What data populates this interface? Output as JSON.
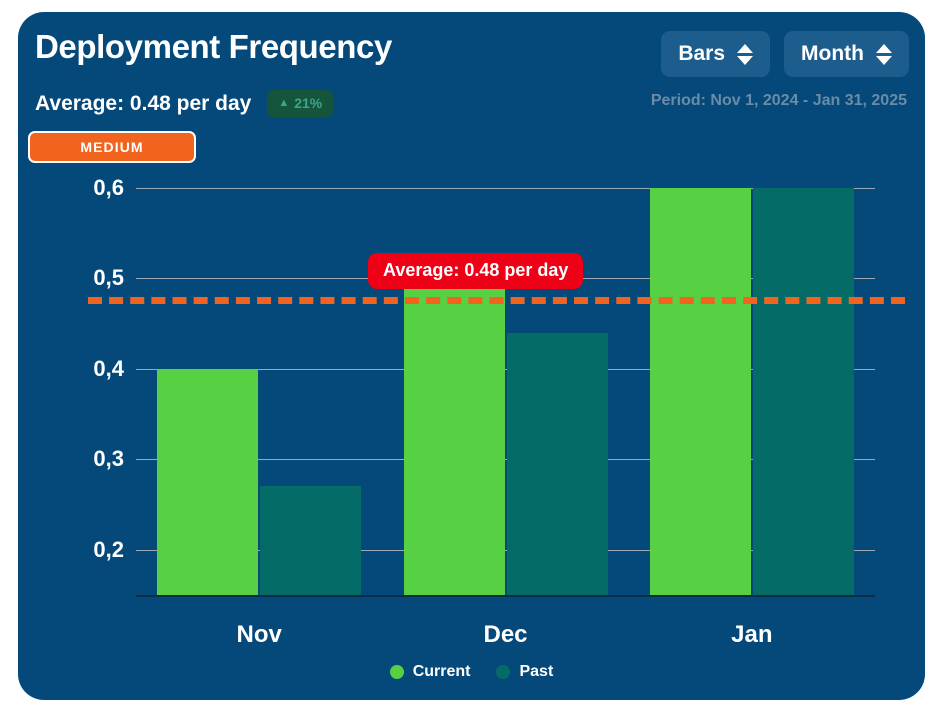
{
  "card": {
    "background_color": "#04497a"
  },
  "header": {
    "title": "Deployment Frequency",
    "average_text": "Average: 0.48 per day",
    "delta_arrow": "▲",
    "delta_label": "21%",
    "delta_color": "#3fa58a",
    "level_label": "MEDIUM",
    "level_color": "#f2641e",
    "period_label": "Period: Nov 1, 2024 - Jan 31, 2025"
  },
  "controls": [
    {
      "name": "chart-type-select",
      "value": "Bars",
      "icon": "updown-chevron-icon"
    },
    {
      "name": "granularity-select",
      "value": "Month",
      "icon": "updown-chevron-icon"
    }
  ],
  "average_marker": {
    "label": "Average: 0.48 per day",
    "value": 0.48,
    "line_color": "#f2641e",
    "badge_color": "#ee0016"
  },
  "legend": [
    {
      "label": "Current",
      "color": "#57d044"
    },
    {
      "label": "Past",
      "color": "#056b66"
    }
  ],
  "chart_data": {
    "type": "bar",
    "title": "Deployment Frequency",
    "xlabel": "",
    "ylabel": "",
    "categories": [
      "Nov",
      "Dec",
      "Jan"
    ],
    "series": [
      {
        "name": "Current",
        "color": "#57d044",
        "values": [
          0.4,
          0.51,
          0.6
        ]
      },
      {
        "name": "Past",
        "color": "#056b66",
        "values": [
          0.27,
          0.44,
          0.6
        ]
      }
    ],
    "ytick_labels": [
      "0,6",
      "0,5",
      "0,4",
      "0,3",
      "0,2"
    ],
    "ytick_values": [
      0.6,
      0.5,
      0.4,
      0.3,
      0.2
    ],
    "ylim": [
      0.15,
      0.625
    ],
    "grid": true,
    "legend_position": "bottom",
    "annotations": [
      {
        "type": "hline",
        "label": "Average: 0.48 per day",
        "value": 0.48,
        "style": "dashed",
        "color": "#f2641e"
      }
    ]
  }
}
